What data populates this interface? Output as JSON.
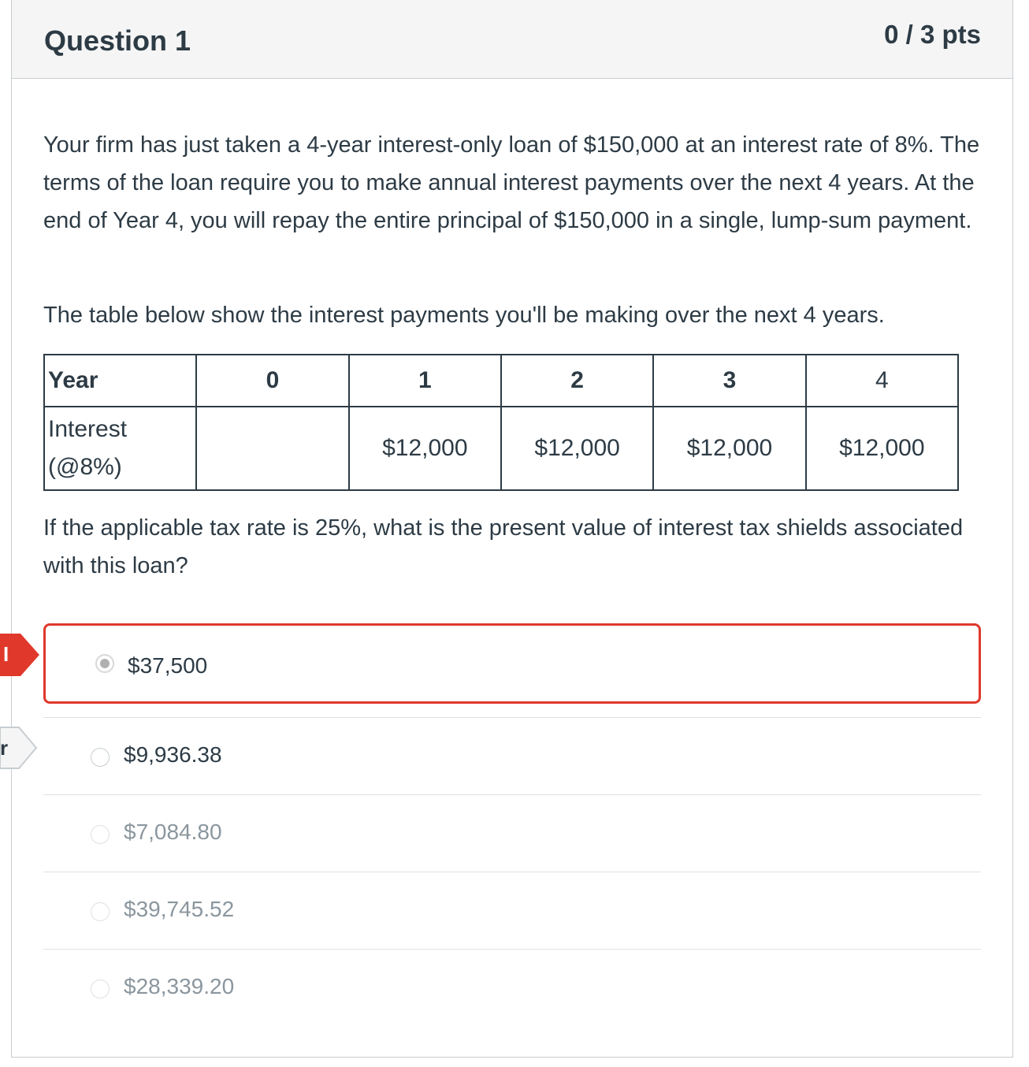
{
  "question": {
    "title": "Question 1",
    "points": "0 / 3 pts",
    "paragraph1": "Your firm has just taken a 4-year interest-only loan of $150,000 at an interest rate of 8%. The terms of the loan require you to make annual interest payments over the next 4 years. At the end of Year 4, you will repay the entire principal of $150,000 in a single, lump-sum payment.",
    "paragraph2": "The table below show the interest payments you'll be making over the next 4 years.",
    "paragraph3": "If the applicable tax rate is 25%, what is the present value of interest tax shields associated with this loan?"
  },
  "table": {
    "header_label": "Year",
    "years": [
      "0",
      "1",
      "2",
      "3",
      "4"
    ],
    "row_label_line1": "Interest",
    "row_label_line2": "(@8%)",
    "values": [
      "",
      "$12,000",
      "$12,000",
      "$12,000",
      "$12,000"
    ]
  },
  "answers": [
    {
      "label": "$37,500",
      "selected": true,
      "status": "incorrect"
    },
    {
      "label": "$9,936.38",
      "selected": false,
      "status": "correct"
    },
    {
      "label": "$7,084.80",
      "selected": false
    },
    {
      "label": "$39,745.52",
      "selected": false
    },
    {
      "label": "$28,339.20",
      "selected": false
    }
  ],
  "flags": {
    "incorrect_text": "I",
    "correct_text": "r"
  },
  "colors": {
    "incorrect": "#e0392b",
    "text": "#2d3b45",
    "header_bg": "#f5f5f5",
    "border": "#c7cdd1"
  }
}
